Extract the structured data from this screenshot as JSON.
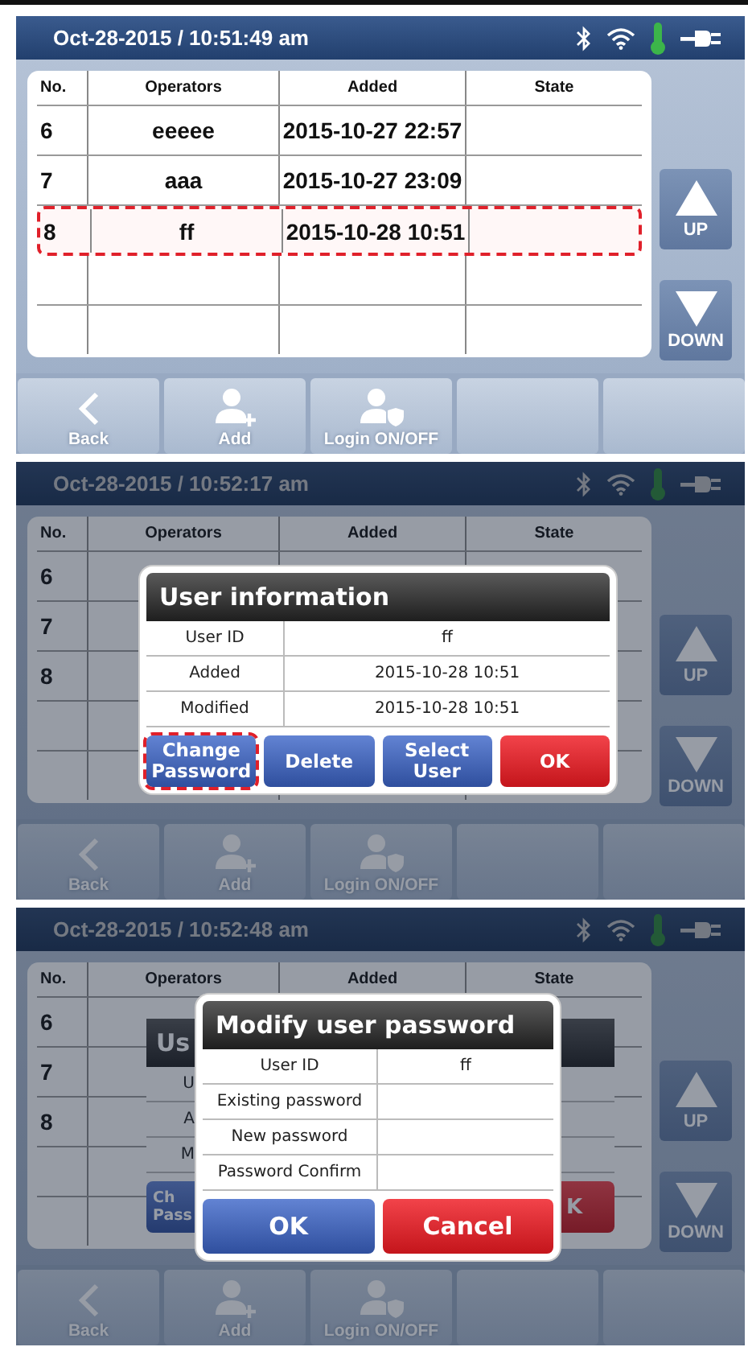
{
  "screens": [
    {
      "status_bar": {
        "datetime": "Oct-28-2015 / 10:51:49 am"
      },
      "dimmed": false,
      "table": {
        "columns": [
          "No.",
          "Operators",
          "Added",
          "State"
        ],
        "rows": [
          {
            "no": "6",
            "operator": "eeeee",
            "added": "2015-10-27 22:57",
            "highlighted": false
          },
          {
            "no": "7",
            "operator": "aaa",
            "added": "2015-10-27 23:09",
            "highlighted": false
          },
          {
            "no": "8",
            "operator": "ff",
            "added": "2015-10-28 10:51",
            "highlighted": true
          }
        ]
      },
      "side_buttons": [
        {
          "label": "UP",
          "kind": "up"
        },
        {
          "label": "DOWN",
          "kind": "down"
        }
      ],
      "toolbar": [
        {
          "label": "Back",
          "kind": "back"
        },
        {
          "label": "Add",
          "kind": "add-user"
        },
        {
          "label": "Login ON/OFF",
          "kind": "login"
        }
      ]
    },
    {
      "status_bar": {
        "datetime": "Oct-28-2015 / 10:52:17 am"
      },
      "dimmed": true,
      "table": {
        "columns": [
          "No.",
          "Operators",
          "Added",
          "State"
        ],
        "rows": [
          {
            "no": "6",
            "highlighted": false
          },
          {
            "no": "7",
            "highlighted": false
          },
          {
            "no": "8",
            "highlighted": false
          }
        ]
      },
      "side_buttons": [
        {
          "label": "UP",
          "kind": "up"
        },
        {
          "label": "DOWN",
          "kind": "down"
        }
      ],
      "toolbar": [
        {
          "label": "Back",
          "kind": "back"
        },
        {
          "label": "Add",
          "kind": "add-user"
        },
        {
          "label": "Login ON/OFF",
          "kind": "login"
        }
      ],
      "dialogs": [
        {
          "kind": "info",
          "title": "User information",
          "rows": [
            {
              "label": "User ID",
              "value": "ff"
            },
            {
              "label": "Added",
              "value": "2015-10-28 10:51"
            },
            {
              "label": "Modified",
              "value": "2015-10-28 10:51"
            }
          ],
          "buttons": [
            {
              "label": "Change Password",
              "kind": "primary",
              "highlighted": true
            },
            {
              "label": "Delete",
              "kind": "primary",
              "highlighted": false
            },
            {
              "label": "Select User",
              "kind": "primary",
              "highlighted": false
            },
            {
              "label": "OK",
              "kind": "danger",
              "highlighted": false
            }
          ]
        }
      ]
    },
    {
      "status_bar": {
        "datetime": "Oct-28-2015 / 10:52:48 am"
      },
      "dimmed": true,
      "table": {
        "columns": [
          "No.",
          "Operators",
          "Added",
          "State"
        ],
        "rows": [
          {
            "no": "6",
            "highlighted": false
          },
          {
            "no": "7",
            "highlighted": false
          },
          {
            "no": "8",
            "highlighted": false
          }
        ]
      },
      "side_buttons": [
        {
          "label": "UP",
          "kind": "up"
        },
        {
          "label": "DOWN",
          "kind": "down"
        }
      ],
      "toolbar": [
        {
          "label": "Back",
          "kind": "back"
        },
        {
          "label": "Add",
          "kind": "add-user"
        },
        {
          "label": "Login ON/OFF",
          "kind": "login"
        }
      ],
      "dialogs": [
        {
          "kind": "covered",
          "title": "Us",
          "row_labels": [
            "U",
            "A",
            "M"
          ],
          "left_button": "Ch\nPass",
          "right_button": "K"
        },
        {
          "kind": "password",
          "title": "Modify user password",
          "rows": [
            {
              "label": "User ID",
              "value": "ff"
            },
            {
              "label": "Existing password"
            },
            {
              "label": "New password"
            },
            {
              "label": "Password Confirm"
            }
          ],
          "buttons": [
            {
              "label": "OK",
              "kind": "primary",
              "highlighted": false
            },
            {
              "label": "Cancel",
              "kind": "danger",
              "highlighted": false
            }
          ]
        }
      ]
    }
  ]
}
